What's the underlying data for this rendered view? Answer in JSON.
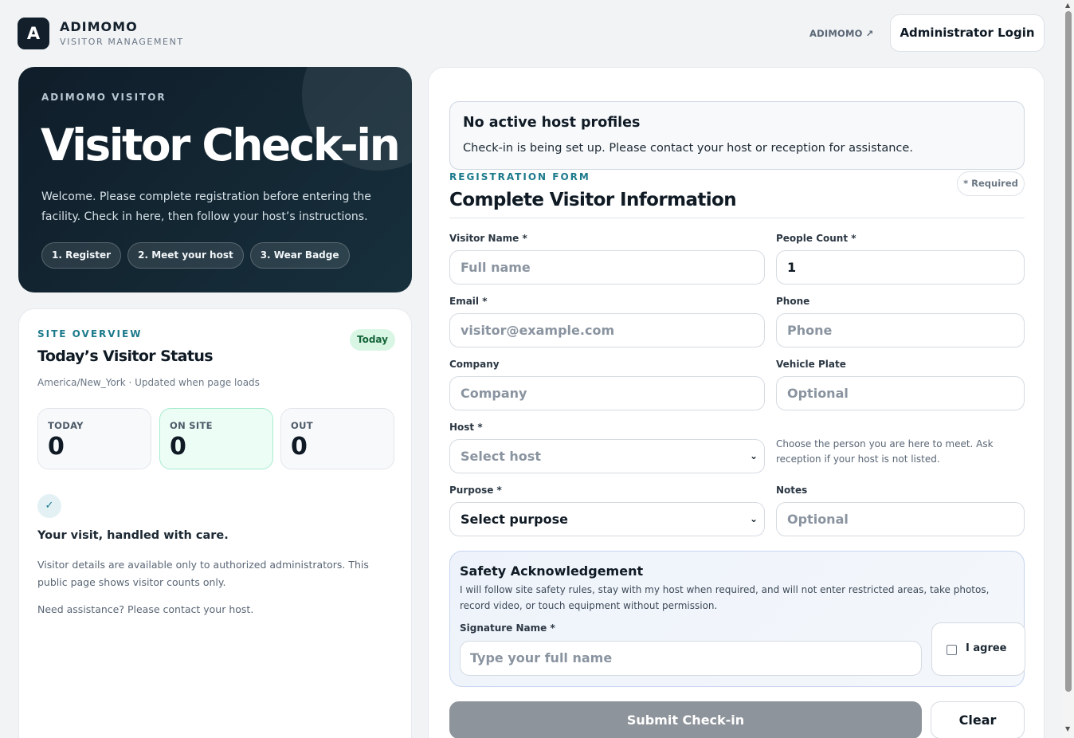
{
  "header": {
    "logo_letter": "A",
    "brand_name": "ADIMOMO",
    "brand_sub": "VISITOR MANAGEMENT",
    "ext_link": "ADIMOMO ↗",
    "admin_button": "Administrator Login"
  },
  "hero": {
    "eyebrow": "ADIMOMO VISITOR",
    "title": "Visitor Check-in",
    "description": "Welcome. Please complete registration before entering the facility. Check in here, then follow your host’s instructions.",
    "steps": [
      "1. Register",
      "2. Meet your host",
      "3. Wear Badge"
    ]
  },
  "overview": {
    "eyebrow": "SITE OVERVIEW",
    "title": "Today’s Visitor Status",
    "badge": "Today",
    "meta": "America/New_York · Updated when page loads",
    "stats": [
      {
        "label": "TODAY",
        "value": "0"
      },
      {
        "label": "ON SITE",
        "value": "0"
      },
      {
        "label": "OUT",
        "value": "0"
      }
    ],
    "check_glyph": "✓",
    "care_title": "Your visit, handled with care.",
    "care_text": "Visitor details are available only to authorized administrators. This public page shows visitor counts only.",
    "assist_text": "Need assistance? Please contact your host."
  },
  "form": {
    "notice_title": "No active host profiles",
    "notice_text": "Check-in is being set up. Please contact your host or reception for assistance.",
    "eyebrow": "REGISTRATION FORM",
    "required_pill": "* Required",
    "title": "Complete Visitor Information",
    "fields": {
      "visitor_name": {
        "label": "Visitor Name *",
        "placeholder": "Full name"
      },
      "people_count": {
        "label": "People Count *",
        "value": "1"
      },
      "email": {
        "label": "Email *",
        "placeholder": "visitor@example.com"
      },
      "phone": {
        "label": "Phone",
        "placeholder": "Phone"
      },
      "company": {
        "label": "Company",
        "placeholder": "Company"
      },
      "vehicle_plate": {
        "label": "Vehicle Plate",
        "placeholder": "Optional"
      },
      "host": {
        "label": "Host *",
        "placeholder": "Select host",
        "help": "Choose the person you are here to meet. Ask reception if your host is not listed."
      },
      "purpose": {
        "label": "Purpose *",
        "value": "Select purpose"
      },
      "notes": {
        "label": "Notes",
        "placeholder": "Optional"
      }
    },
    "safety": {
      "title": "Safety Acknowledgement",
      "text": "I will follow site safety rules, stay with my host when required, and will not enter restricted areas, take photos, record video, or touch equipment without permission.",
      "signature_label": "Signature Name *",
      "signature_placeholder": "Type your full name",
      "agree_label": "I agree"
    },
    "submit_button": "Submit Check-in",
    "clear_button": "Clear"
  },
  "scroll": {
    "up": "▲",
    "down": "▼"
  },
  "colors": {
    "accent": "#1c7a8c",
    "hero_bg": "#0f1d29",
    "submit_disabled": "#8e949b"
  }
}
